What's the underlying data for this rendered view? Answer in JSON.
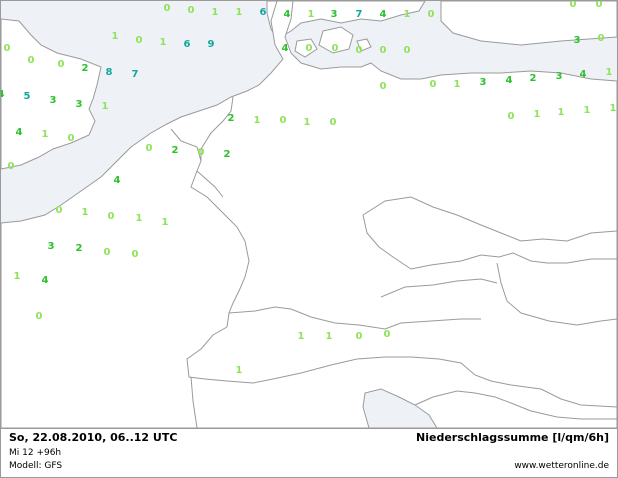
{
  "colors": {
    "sea": "#eef2f7",
    "land": "#ffffff",
    "border": "#9a9a9a",
    "light": "#8ee35a",
    "mid": "#2cc22c",
    "dark": "#1aa36a",
    "teal": "#12a79d"
  },
  "labels": [
    {
      "v": "0",
      "c": "light"
    },
    {
      "v": "0",
      "c": "light"
    },
    {
      "v": "1",
      "c": "light"
    },
    {
      "v": "1",
      "c": "light"
    },
    {
      "v": "6",
      "c": "teal"
    },
    {
      "v": "4",
      "c": "mid"
    },
    {
      "v": "1",
      "c": "light"
    },
    {
      "v": "3",
      "c": "mid"
    },
    {
      "v": "7",
      "c": "teal"
    },
    {
      "v": "4",
      "c": "mid"
    },
    {
      "v": "1",
      "c": "light"
    },
    {
      "v": "0",
      "c": "light"
    },
    {
      "v": "0",
      "c": "light"
    },
    {
      "v": "1",
      "c": "light"
    },
    {
      "v": "0",
      "c": "light"
    },
    {
      "v": "1",
      "c": "light"
    },
    {
      "v": "6",
      "c": "teal"
    },
    {
      "v": "9",
      "c": "teal"
    },
    {
      "v": "4",
      "c": "mid"
    },
    {
      "v": "0",
      "c": "light"
    },
    {
      "v": "0",
      "c": "light"
    },
    {
      "v": "0",
      "c": "light"
    },
    {
      "v": "0",
      "c": "light"
    },
    {
      "v": "0",
      "c": "light"
    },
    {
      "v": "0",
      "c": "light"
    },
    {
      "v": "0",
      "c": "light"
    },
    {
      "v": "0",
      "c": "light"
    },
    {
      "v": "0",
      "c": "light"
    },
    {
      "v": "2",
      "c": "mid"
    },
    {
      "v": "8",
      "c": "teal"
    },
    {
      "v": "7",
      "c": "teal"
    },
    {
      "v": "3",
      "c": "mid"
    },
    {
      "v": "0",
      "c": "light"
    },
    {
      "v": "0",
      "c": "light"
    },
    {
      "v": "0",
      "c": "light"
    },
    {
      "v": "1",
      "c": "light"
    },
    {
      "v": "3",
      "c": "mid"
    },
    {
      "v": "4",
      "c": "mid"
    },
    {
      "v": "2",
      "c": "mid"
    },
    {
      "v": "3",
      "c": "mid"
    },
    {
      "v": "4",
      "c": "mid"
    },
    {
      "v": "1",
      "c": "light"
    },
    {
      "v": "4",
      "c": "mid"
    },
    {
      "v": "5",
      "c": "teal"
    },
    {
      "v": "3",
      "c": "mid"
    },
    {
      "v": "3",
      "c": "mid"
    },
    {
      "v": "1",
      "c": "light"
    },
    {
      "v": "4",
      "c": "mid"
    },
    {
      "v": "1",
      "c": "light"
    },
    {
      "v": "0",
      "c": "light"
    },
    {
      "v": "2",
      "c": "mid"
    },
    {
      "v": "1",
      "c": "light"
    },
    {
      "v": "0",
      "c": "light"
    },
    {
      "v": "1",
      "c": "light"
    },
    {
      "v": "0",
      "c": "light"
    },
    {
      "v": "0",
      "c": "light"
    },
    {
      "v": "1",
      "c": "light"
    },
    {
      "v": "1",
      "c": "light"
    },
    {
      "v": "1",
      "c": "light"
    },
    {
      "v": "1",
      "c": "light"
    },
    {
      "v": "0",
      "c": "light"
    },
    {
      "v": "2",
      "c": "mid"
    },
    {
      "v": "0",
      "c": "light"
    },
    {
      "v": "2",
      "c": "mid"
    },
    {
      "v": "0",
      "c": "light"
    },
    {
      "v": "4",
      "c": "mid"
    },
    {
      "v": "0",
      "c": "light"
    },
    {
      "v": "1",
      "c": "light"
    },
    {
      "v": "0",
      "c": "light"
    },
    {
      "v": "1",
      "c": "light"
    },
    {
      "v": "1",
      "c": "light"
    },
    {
      "v": "3",
      "c": "mid"
    },
    {
      "v": "2",
      "c": "mid"
    },
    {
      "v": "0",
      "c": "light"
    },
    {
      "v": "0",
      "c": "light"
    },
    {
      "v": "1",
      "c": "light"
    },
    {
      "v": "4",
      "c": "mid"
    },
    {
      "v": "0",
      "c": "light"
    },
    {
      "v": "1",
      "c": "light"
    },
    {
      "v": "1",
      "c": "light"
    },
    {
      "v": "0",
      "c": "light"
    },
    {
      "v": "0",
      "c": "light"
    },
    {
      "v": "1",
      "c": "light"
    }
  ],
  "footer": {
    "date": "So, 22.08.2010, 06..12 UTC",
    "run": "Mi 12 +96h",
    "model": "Modell: GFS",
    "legend": "Niederschlagssumme [l/qm/6h]",
    "source": "www.wetteronline.de"
  }
}
